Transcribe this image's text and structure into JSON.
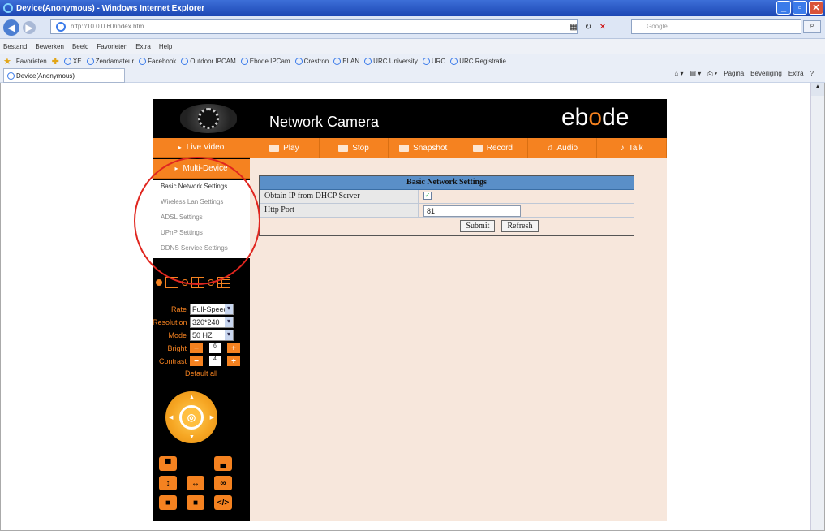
{
  "window": {
    "title": "Device(Anonymous) - Windows Internet Explorer"
  },
  "addressbar": {
    "url": "http://10.0.0.60/index.htm",
    "search_placeholder": "Google"
  },
  "menubar": [
    "Bestand",
    "Bewerken",
    "Beeld",
    "Favorieten",
    "Extra",
    "Help"
  ],
  "favorites": {
    "label": "Favorieten",
    "items": [
      "XE",
      "Zendamateur",
      "Facebook",
      "Outdoor IPCAM",
      "Ebode IPCam",
      "Crestron",
      "ELAN",
      "URC University",
      "URC",
      "URC Registratie"
    ]
  },
  "tab": {
    "label": "Device(Anonymous)"
  },
  "commandbar": [
    "Pagina",
    "Beveiliging",
    "Extra"
  ],
  "camera": {
    "title": "Network Camera",
    "brand_prefix": "eb",
    "brand_o": "o",
    "brand_suffix": "de",
    "sidebar": {
      "live_video": "Live Video",
      "multi_device": "Multi-Device"
    },
    "tabs": [
      "Play",
      "Stop",
      "Snapshot",
      "Record",
      "Audio",
      "Talk"
    ],
    "submenu": [
      "Basic Network Settings",
      "Wireless Lan Settings",
      "ADSL Settings",
      "UPnP Settings",
      "DDNS Service Settings"
    ],
    "controls": {
      "rate_label": "Rate",
      "rate_value": "Full-Speed",
      "resolution_label": "Resolution",
      "resolution_value": "320*240",
      "mode_label": "Mode",
      "mode_value": "50 HZ",
      "bright_label": "Bright",
      "bright_value": "6",
      "contrast_label": "Contrast",
      "contrast_value": "4",
      "default_all": "Default all"
    },
    "form": {
      "header": "Basic Network Settings",
      "dhcp_label": "Obtain IP from DHCP Server",
      "dhcp_checked": true,
      "http_port_label": "Http Port",
      "http_port_value": "81",
      "submit": "Submit",
      "refresh": "Refresh"
    }
  },
  "colors": {
    "accent": "#f58220",
    "highlight": "#e0261f",
    "form_header": "#5a8fc8",
    "content_bg": "#f7e7dc"
  }
}
